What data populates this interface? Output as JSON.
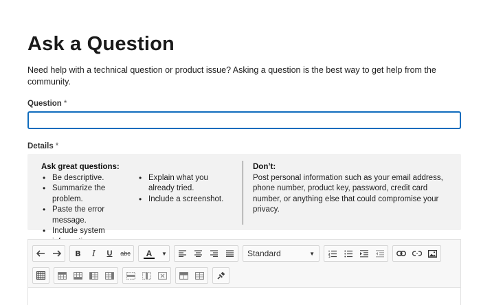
{
  "page": {
    "title": "Ask a Question",
    "intro": "Need help with a technical question or product issue? Asking a question is the best way to get help from the community."
  },
  "question": {
    "label": "Question",
    "required_marker": "*",
    "value": "",
    "placeholder": ""
  },
  "details": {
    "label": "Details",
    "required_marker": "*"
  },
  "tips": {
    "do_heading": "Ask great questions:",
    "do_items_col1": [
      "Be descriptive.",
      "Summarize the problem.",
      "Paste the error message.",
      "Include system information."
    ],
    "do_items_col2": [
      "Explain what you already tried.",
      "Include a screenshot."
    ],
    "dont_heading": "Don’t:",
    "dont_text": "Post personal information such as your email address, phone number, product key, password, credit card number, or anything else that could compromise your privacy."
  },
  "toolbar": {
    "bold_label": "B",
    "italic_label": "I",
    "underline_label": "U",
    "strike_label": "abc",
    "font_color_label": "A",
    "paragraph_style": "Standard",
    "icons_row1": [
      "undo-icon",
      "redo-icon",
      "bold-icon",
      "italic-icon",
      "underline-icon",
      "strikethrough-icon",
      "font-color-icon",
      "align-left-icon",
      "align-center-icon",
      "align-right-icon",
      "align-justify-icon",
      "paragraph-style-select",
      "numbered-list-icon",
      "bulleted-list-icon",
      "indent-icon",
      "outdent-icon",
      "link-icon",
      "unlink-icon",
      "image-icon"
    ],
    "icons_row2": [
      "table-icon",
      "insert-row-above-icon",
      "insert-row-below-icon",
      "insert-column-left-icon",
      "insert-column-right-icon",
      "delete-row-icon",
      "delete-column-icon",
      "delete-table-icon",
      "merge-cells-icon",
      "split-cells-icon",
      "clear-formatting-icon"
    ]
  },
  "colors": {
    "accent": "#0f6cbd",
    "tips_bg": "#f2f2f2",
    "toolbar_bg": "#f7f7f7"
  }
}
